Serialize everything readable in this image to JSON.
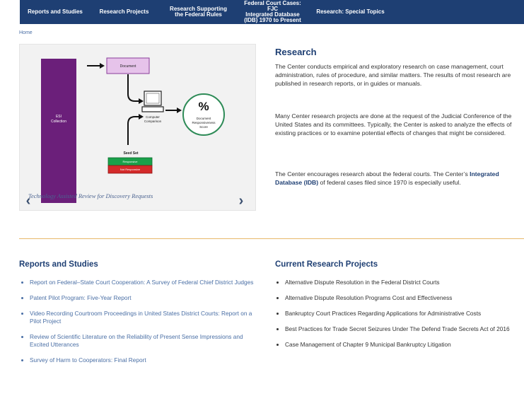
{
  "nav": {
    "items": [
      {
        "label": "Reports and Studies"
      },
      {
        "label": "Research Projects"
      },
      {
        "label": "Research Supporting\nthe Federal Rules"
      },
      {
        "label": "Federal Court Cases: FJC\nIntegrated Database\n(IDB) 1970 to Present"
      },
      {
        "label": "Research: Special Topics"
      }
    ]
  },
  "breadcrumb": "Home",
  "carousel": {
    "caption": "Technology Assisted Review for Discovery Requests",
    "diagram": {
      "esi_line1": "ESI",
      "esi_line2": "Collection",
      "document": "Document",
      "computer_line1": "Computer",
      "computer_line2": "Comparison",
      "percent": "%",
      "score_line1": "Document",
      "score_line2": "Responsiveness",
      "score_line3": "Score",
      "seed_set": "Seed Set",
      "responsive": "Responsive",
      "not_responsive": "Not Responsive"
    },
    "colors": {
      "esi": "#6b1f7a",
      "document": "#e6c3ea",
      "responsive": "#1aa04a",
      "not_responsive": "#d42a2a"
    }
  },
  "research": {
    "title": "Research",
    "p1": "The Center conducts empirical and exploratory research on case management, court administration, rules of procedure, and similar matters. The results of most research are published in research reports, or in guides or manuals.",
    "p2": "Many Center research projects are done at the request of the Judicial Conference of the United States and its committees. Typically, the Center is asked to analyze the effects of existing practices or to examine potential effects of changes that might be considered.",
    "p3_before": "The Center encourages research about the federal courts. The Center’s ",
    "p3_link": "Integrated Database (IDB)",
    "p3_after": " of federal cases filed since 1970 is especially useful."
  },
  "reports": {
    "title": "Reports and Studies",
    "items": [
      "Report on Federal–State Court Cooperation: A Survey of Federal Chief District Judges",
      "Patent Pilot Program: Five-Year Report",
      "Video Recording Courtroom Proceedings in United States District Courts: Report on a Pilot Project",
      "Review of Scientific Literature on the Reliability of Present Sense Impressions and Excited Utterances",
      "Survey of Harm to Cooperators: Final Report"
    ]
  },
  "projects": {
    "title": "Current Research Projects",
    "items": [
      "Alternative Dispute Resolution in the Federal District Courts",
      "Alternative Dispute Resolution Programs Cost and Effectiveness",
      "Bankruptcy Court Practices Regarding Applications for Administrative Costs",
      "Best Practices for Trade Secret Seizures Under The Defend Trade Secrets Act of 2016",
      "Case Management of Chapter 9 Municipal Bankruptcy Litigation"
    ]
  }
}
